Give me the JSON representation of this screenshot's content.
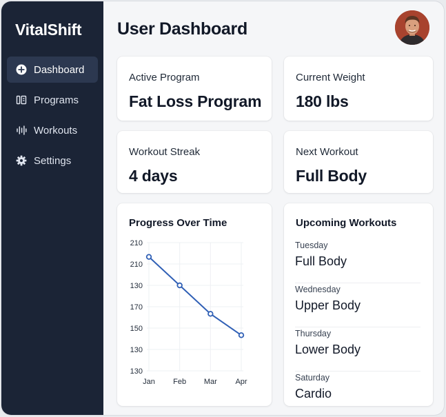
{
  "app": {
    "name": "VitalShift"
  },
  "sidebar": {
    "items": [
      {
        "label": "Dashboard",
        "icon": "plus-circle-icon",
        "active": true
      },
      {
        "label": "Programs",
        "icon": "programs-icon",
        "active": false
      },
      {
        "label": "Workouts",
        "icon": "bars-icon",
        "active": false
      },
      {
        "label": "Settings",
        "icon": "gear-icon",
        "active": false
      }
    ]
  },
  "header": {
    "title": "User Dashboard"
  },
  "stats": {
    "active_program": {
      "label": "Active Program",
      "value": "Fat Loss Program"
    },
    "current_weight": {
      "label": "Current Weight",
      "value": "180 lbs"
    },
    "workout_streak": {
      "label": "Workout Streak",
      "value": "4 days"
    },
    "next_workout": {
      "label": "Next Workout",
      "value": "Full Body"
    }
  },
  "chart_data": {
    "type": "line",
    "title": "Progress Over Time",
    "categories": [
      "Jan",
      "Feb",
      "Mar",
      "Apr"
    ],
    "y_tick_labels": [
      "210",
      "210",
      "130",
      "170",
      "150",
      "130",
      "130"
    ],
    "series": [
      {
        "values": [
          210,
          190,
          170,
          155
        ]
      }
    ],
    "ylim": [
      130,
      220
    ],
    "grid": true,
    "line_color": "#2f5fb5"
  },
  "upcoming": {
    "title": "Upcoming Workouts",
    "items": [
      {
        "day": "Tuesday",
        "workout": "Full Body"
      },
      {
        "day": "Wednesday",
        "workout": "Upper Body"
      },
      {
        "day": "Thursday",
        "workout": "Lower Body"
      },
      {
        "day": "Saturday",
        "workout": "Cardio"
      }
    ]
  },
  "colors": {
    "sidebar_bg": "#1b2436",
    "active_item_bg": "#2c3850",
    "accent": "#2f5fb5"
  }
}
